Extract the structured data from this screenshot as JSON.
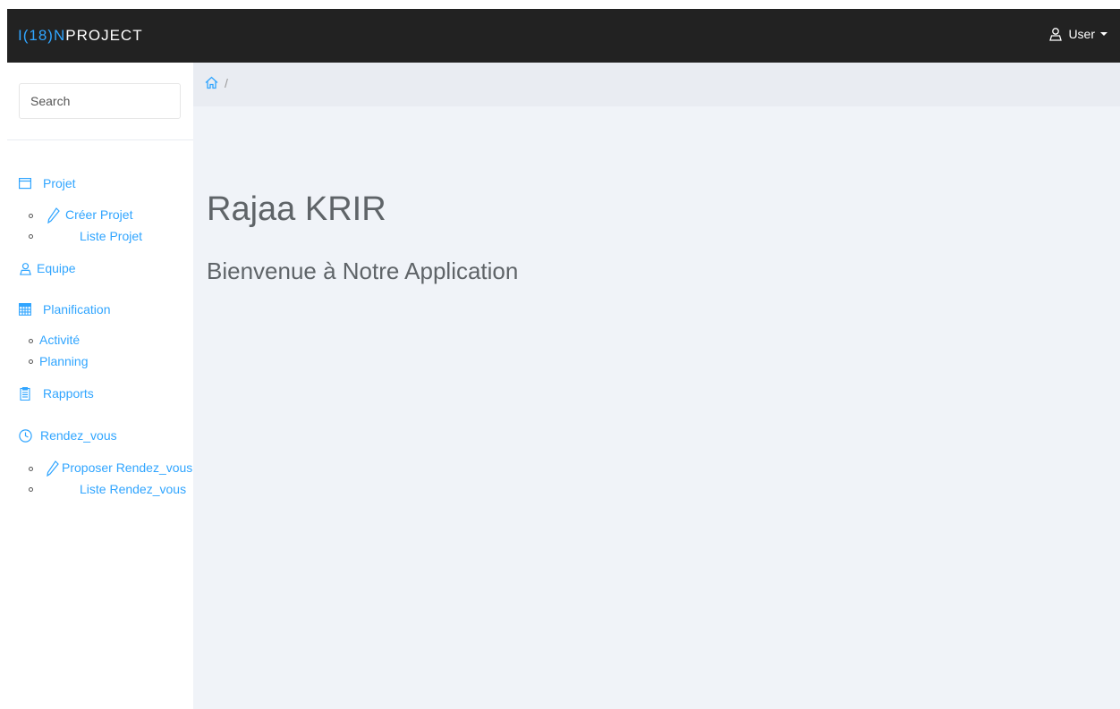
{
  "navbar": {
    "brand_prefix": "I(18)N",
    "brand_suffix": "PROJECT",
    "user_label": "User"
  },
  "sidebar": {
    "search_placeholder": "Search",
    "projet": {
      "label": "Projet",
      "sub": [
        "Créer Projet",
        "Liste Projet"
      ]
    },
    "equipe": {
      "label": "Equipe"
    },
    "planification": {
      "label": "Planification",
      "sub": [
        "Activité",
        "Planning"
      ]
    },
    "rapports": {
      "label": "Rapports"
    },
    "rendez_vous": {
      "label": "Rendez_vous",
      "sub": [
        "Proposer Rendez_vous",
        "Liste Rendez_vous"
      ]
    }
  },
  "breadcrumb": {
    "separator": "/"
  },
  "main": {
    "title": "Rajaa KRIR",
    "subtitle": "Bienvenue à Notre Application"
  },
  "colors": {
    "accent": "#30a5ff",
    "navbar_bg": "#222222",
    "main_bg": "#f0f3f8",
    "breadcrumb_bg": "#e9ecf2",
    "text": "#5f6468"
  },
  "icons": {
    "user": "user-icon",
    "caret": "caret-down-icon",
    "home": "home-icon",
    "projet": "window-icon",
    "edit": "pencil-icon",
    "equipe": "user-icon",
    "planification": "calendar-icon",
    "rapports": "clipboard-icon",
    "rendez_vous": "clock-icon"
  }
}
